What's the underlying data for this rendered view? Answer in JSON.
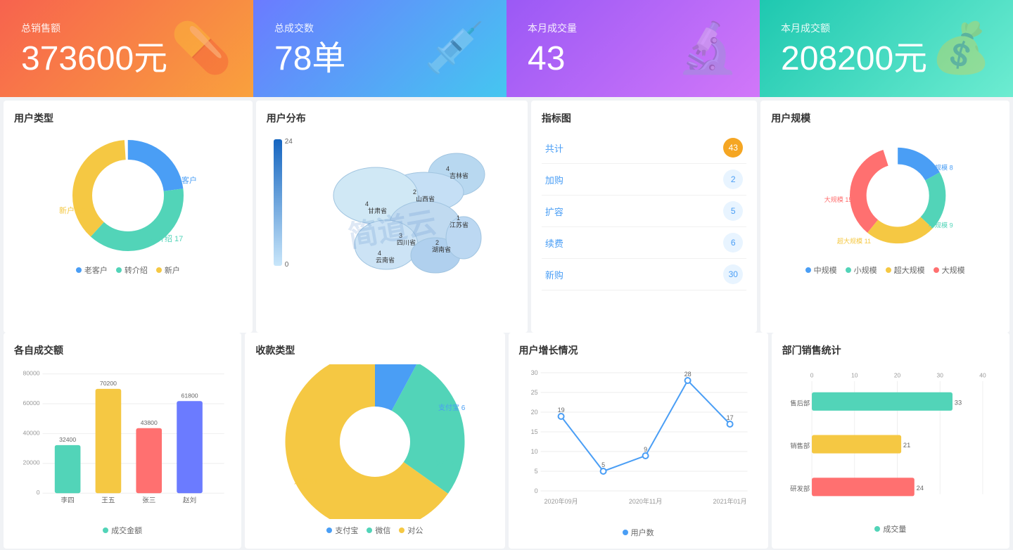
{
  "kpi": [
    {
      "label": "总销售额",
      "value": "373600元",
      "icon": "💊"
    },
    {
      "label": "总成交数",
      "value": "78单",
      "icon": "💉"
    },
    {
      "label": "本月成交量",
      "value": "43",
      "icon": "🔬"
    },
    {
      "label": "本月成交额",
      "value": "208200元",
      "icon": "💰"
    }
  ],
  "user_type": {
    "title": "用户类型",
    "segments": [
      {
        "label": "老客户",
        "value": 10,
        "color": "#4a9ef5",
        "percent": 23
      },
      {
        "label": "转介绍",
        "value": 17,
        "color": "#52d4b8",
        "percent": 39
      },
      {
        "label": "新户",
        "value": 16,
        "color": "#f5c843",
        "percent": 37
      }
    ],
    "legend": [
      "老客户",
      "转介绍",
      "新户"
    ]
  },
  "user_dist": {
    "title": "用户分布",
    "scale_max": 24,
    "scale_min": 0,
    "provinces": [
      {
        "name": "吉林省",
        "value": 4
      },
      {
        "name": "山西省",
        "value": 2
      },
      {
        "name": "甘肃省",
        "value": 4
      },
      {
        "name": "江苏省",
        "value": 1
      },
      {
        "name": "四川省",
        "value": 3
      },
      {
        "name": "湖南省",
        "value": 2
      },
      {
        "name": "云南省",
        "value": 4
      }
    ]
  },
  "indicator": {
    "title": "指标图",
    "rows": [
      {
        "label": "共计",
        "value": 43,
        "highlight": true
      },
      {
        "label": "加购",
        "value": 2,
        "highlight": false
      },
      {
        "label": "扩容",
        "value": 5,
        "highlight": false
      },
      {
        "label": "续费",
        "value": 6,
        "highlight": false
      },
      {
        "label": "新购",
        "value": 30,
        "highlight": false
      }
    ]
  },
  "user_scale": {
    "title": "用户规模",
    "segments": [
      {
        "label": "中规模",
        "value": 8,
        "color": "#4a9ef5",
        "percent": 18
      },
      {
        "label": "小规模",
        "value": 9,
        "color": "#52d4b8",
        "percent": 21
      },
      {
        "label": "超大规模",
        "value": 11,
        "color": "#f5c843",
        "percent": 25
      },
      {
        "label": "大规模",
        "value": 15,
        "color": "#ff7070",
        "percent": 36
      }
    ],
    "legend": [
      "中规模",
      "小规模",
      "超大规模",
      "大规模"
    ]
  },
  "bar_chart": {
    "title": "各自成交额",
    "y_labels": [
      "80000",
      "60000",
      "40000",
      "20000",
      "0"
    ],
    "bars": [
      {
        "label": "李四",
        "value": 32400,
        "height_pct": 40,
        "color": "#52d4b8"
      },
      {
        "label": "王五",
        "value": 70200,
        "height_pct": 88,
        "color": "#f5c843"
      },
      {
        "label": "张三",
        "value": 43800,
        "height_pct": 55,
        "color": "#ff7070"
      },
      {
        "label": "赵刘",
        "value": 61800,
        "height_pct": 77,
        "color": "#6b7bff"
      }
    ],
    "legend": "成交金额"
  },
  "payment_type": {
    "title": "收款类型",
    "segments": [
      {
        "label": "支付宝",
        "value": 6,
        "color": "#4a9ef5",
        "percent": 8
      },
      {
        "label": "微信",
        "value": 21,
        "color": "#52d4b8",
        "percent": 27
      },
      {
        "label": "对公",
        "value": 51,
        "color": "#f5c843",
        "percent": 65
      }
    ],
    "legend": [
      "支付宝",
      "微信",
      "对公"
    ]
  },
  "user_growth": {
    "title": "用户增长情况",
    "y_max": 30,
    "y_labels": [
      "30",
      "25",
      "20",
      "15",
      "10",
      "5",
      "0"
    ],
    "x_labels": [
      "2020年09月",
      "2020年11月",
      "2021年01月"
    ],
    "points": [
      {
        "x": 0,
        "y": 19,
        "label": "19"
      },
      {
        "x": 1,
        "y": 5,
        "label": "5"
      },
      {
        "x": 2,
        "y": 9,
        "label": "9"
      },
      {
        "x": 3,
        "y": 28,
        "label": "28"
      },
      {
        "x": 4,
        "y": 17,
        "label": "17"
      }
    ],
    "legend": "用户数"
  },
  "dept_sales": {
    "title": "部门销售统计",
    "x_labels": [
      "0",
      "10",
      "20",
      "30",
      "40"
    ],
    "bars": [
      {
        "label": "售后部",
        "value": 33,
        "color": "#52d4b8",
        "pct": 82
      },
      {
        "label": "销售部",
        "value": 21,
        "color": "#f5c843",
        "pct": 52
      },
      {
        "label": "研发部",
        "value": 24,
        "color": "#ff7070",
        "pct": 60
      }
    ],
    "legend": "成交量"
  },
  "watermark": "简道云"
}
